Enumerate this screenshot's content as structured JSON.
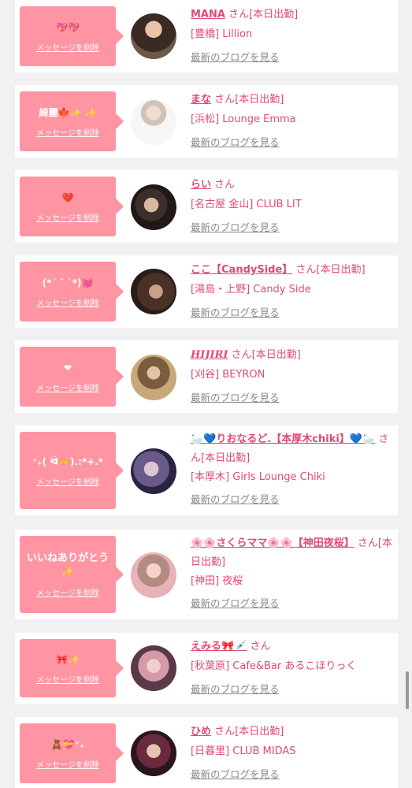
{
  "entries": [
    {
      "message": "💖💖",
      "delete_label": "メッセージを削除",
      "name": "MANA",
      "suffix": "さん",
      "status": "[本日出勤]",
      "shop": "[豊橋] Lillion",
      "blog_link": "最新のブログを見る"
    },
    {
      "message": "綺麗🍁✨ ✨",
      "delete_label": "メッセージを削除",
      "name": "まな",
      "suffix": "さん",
      "status": "[本日出勤]",
      "shop": "[浜松] Lounge Emma",
      "blog_link": "最新のブログを見る"
    },
    {
      "message": "❤️",
      "delete_label": "メッセージを削除",
      "name": "らい",
      "suffix": "さん",
      "status": "",
      "shop": "[名古屋 金山] CLUB LIT",
      "blog_link": "最新のブログを見る"
    },
    {
      "message": "(*ˊ ˘ ˋ*)💓",
      "delete_label": "メッセージを削除",
      "name": "ここ【CandySide】",
      "suffix": "さん",
      "status": "[本日出勤]",
      "shop": "[湯島・上野] Candy Side",
      "blog_link": "最新のブログを見る"
    },
    {
      "message": "❤",
      "delete_label": "メッセージを削除",
      "name": "HIJIRI",
      "suffix": "さん",
      "status": "[本日出勤]",
      "shop": "[刈谷] BEYRON",
      "blog_link": "最新のブログを見る"
    },
    {
      "message": "⁺₊( ᐛ👐).:*+.*",
      "delete_label": "メッセージを削除",
      "name": "🦢💙りおなるど.【本厚木chiki】💙🦢",
      "suffix": "さん",
      "status": "[本日出勤]",
      "shop": "[本厚木] Girls Lounge Chiki",
      "blog_link": "最新のブログを見る"
    },
    {
      "message": "いいねありがとう✨",
      "delete_label": "メッセージを削除",
      "name": "🌸🌸さくらママ🌸🌸【神田夜桜】",
      "suffix": "さん",
      "status": "[本日出勤]",
      "shop": "[神田] 夜桜",
      "blog_link": "最新のブログを見る"
    },
    {
      "message": "🎀✨",
      "delete_label": "メッセージを削除",
      "name": "えみる🎀💉",
      "suffix": "さん",
      "status": "",
      "shop": "[秋葉原] Cafe&Bar あるこほりっく",
      "blog_link": "最新のブログを見る"
    },
    {
      "message": "🧸💝⁺₊",
      "delete_label": "メッセージを削除",
      "name": "ひめ",
      "suffix": "さん",
      "status": "[本日出勤]",
      "shop": "[日暮里] CLUB MIDAS",
      "blog_link": "最新のブログを見る"
    }
  ]
}
